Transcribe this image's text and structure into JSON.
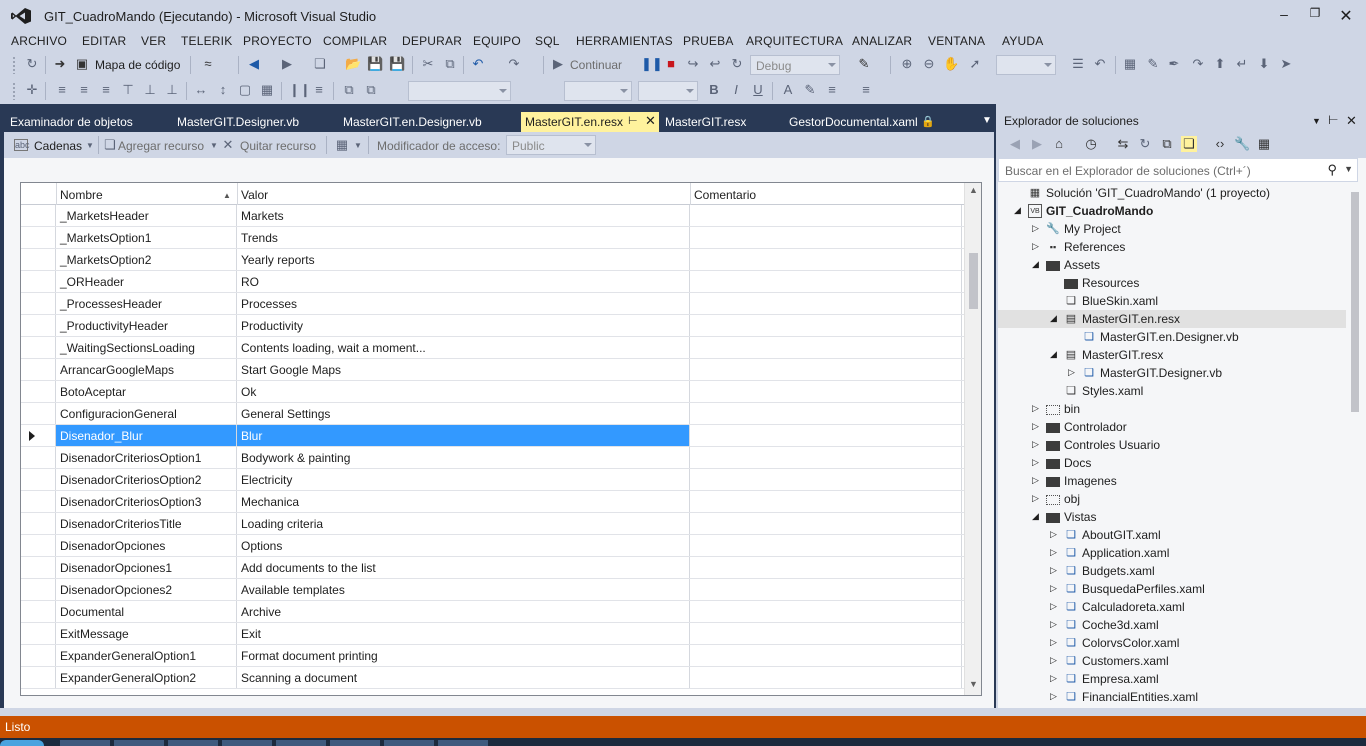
{
  "window": {
    "title": "GIT_CuadroMando (Ejecutando) - Microsoft Visual Studio"
  },
  "menu": [
    "ARCHIVO",
    "EDITAR",
    "VER",
    "TELERIK",
    "PROYECTO",
    "COMPILAR",
    "DEPURAR",
    "EQUIPO",
    "SQL",
    "HERRAMIENTAS",
    "PRUEBA",
    "ARQUITECTURA",
    "ANALIZAR",
    "VENTANA",
    "AYUDA"
  ],
  "toolbar": {
    "code_map": "Mapa de código",
    "continue": "Continuar",
    "config": "Debug"
  },
  "tabs": [
    {
      "label": "Examinador de objetos"
    },
    {
      "label": "MasterGIT.Designer.vb"
    },
    {
      "label": "MasterGIT.en.Designer.vb"
    },
    {
      "label": "MasterGIT.en.resx",
      "active": true
    },
    {
      "label": "MasterGIT.resx"
    },
    {
      "label": "GestorDocumental.xaml"
    }
  ],
  "resx": {
    "toolbar": {
      "strings": "Cadenas",
      "add": "Agregar recurso",
      "remove": "Quitar recurso",
      "access_label": "Modificador de acceso:",
      "access_value": "Public"
    },
    "columns": {
      "name": "Nombre",
      "value": "Valor",
      "comment": "Comentario"
    },
    "rows": [
      {
        "name": "_MarketsHeader",
        "value": "Markets"
      },
      {
        "name": "_MarketsOption1",
        "value": "Trends"
      },
      {
        "name": "_MarketsOption2",
        "value": "Yearly reports"
      },
      {
        "name": "_ORHeader",
        "value": "RO"
      },
      {
        "name": "_ProcessesHeader",
        "value": "Processes"
      },
      {
        "name": "_ProductivityHeader",
        "value": "Productivity"
      },
      {
        "name": "_WaitingSectionsLoading",
        "value": "Contents loading, wait a moment..."
      },
      {
        "name": "ArrancarGoogleMaps",
        "value": "Start Google Maps"
      },
      {
        "name": "BotoAceptar",
        "value": "Ok"
      },
      {
        "name": "ConfiguracionGeneral",
        "value": "General Settings"
      },
      {
        "name": "Disenador_Blur",
        "value": "Blur",
        "selected": true
      },
      {
        "name": "DisenadorCriteriosOption1",
        "value": "Bodywork & painting"
      },
      {
        "name": "DisenadorCriteriosOption2",
        "value": "Electricity"
      },
      {
        "name": "DisenadorCriteriosOption3",
        "value": "Mechanica"
      },
      {
        "name": "DisenadorCriteriosTitle",
        "value": "Loading criteria"
      },
      {
        "name": "DisenadorOpciones",
        "value": "Options"
      },
      {
        "name": "DisenadorOpciones1",
        "value": "Add documents to the list"
      },
      {
        "name": "DisenadorOpciones2",
        "value": "Available templates"
      },
      {
        "name": "Documental",
        "value": "Archive"
      },
      {
        "name": "ExitMessage",
        "value": "Exit"
      },
      {
        "name": "ExpanderGeneralOption1",
        "value": "Format document printing"
      },
      {
        "name": "ExpanderGeneralOption2",
        "value": "Scanning a document"
      }
    ]
  },
  "solution_explorer": {
    "title": "Explorador de soluciones",
    "search_placeholder": "Buscar en el Explorador de soluciones (Ctrl+´)",
    "tree": [
      {
        "label": "Solución 'GIT_CuadroMando'  (1 proyecto)",
        "level": 0,
        "icon": "solution-icon",
        "exp": ""
      },
      {
        "label": "GIT_CuadroMando",
        "level": 0,
        "icon": "vb-project-icon",
        "exp": "open",
        "bold": true
      },
      {
        "label": "My Project",
        "level": 1,
        "icon": "wrench-icon",
        "exp": "closed"
      },
      {
        "label": "References",
        "level": 1,
        "icon": "references-icon",
        "exp": "closed"
      },
      {
        "label": "Assets",
        "level": 1,
        "icon": "folder-icon",
        "exp": "open"
      },
      {
        "label": "Resources",
        "level": 2,
        "icon": "folder-icon",
        "exp": ""
      },
      {
        "label": "BlueSkin.xaml",
        "level": 2,
        "icon": "file-icon",
        "exp": ""
      },
      {
        "label": "MasterGIT.en.resx",
        "level": 2,
        "icon": "resx-icon",
        "exp": "open",
        "highlight": true
      },
      {
        "label": "MasterGIT.en.Designer.vb",
        "level": 3,
        "icon": "vb-file-icon",
        "exp": ""
      },
      {
        "label": "MasterGIT.resx",
        "level": 2,
        "icon": "resx-icon",
        "exp": "open"
      },
      {
        "label": "MasterGIT.Designer.vb",
        "level": 3,
        "icon": "vb-file-icon",
        "exp": "closed"
      },
      {
        "label": "Styles.xaml",
        "level": 2,
        "icon": "file-icon",
        "exp": ""
      },
      {
        "label": "bin",
        "level": 1,
        "icon": "dotted-folder-icon",
        "exp": "closed"
      },
      {
        "label": "Controlador",
        "level": 1,
        "icon": "folder-icon",
        "exp": "closed"
      },
      {
        "label": "Controles Usuario",
        "level": 1,
        "icon": "folder-icon",
        "exp": "closed"
      },
      {
        "label": "Docs",
        "level": 1,
        "icon": "folder-icon",
        "exp": "closed"
      },
      {
        "label": "Imagenes",
        "level": 1,
        "icon": "folder-icon",
        "exp": "closed"
      },
      {
        "label": "obj",
        "level": 1,
        "icon": "dotted-folder-icon",
        "exp": "closed"
      },
      {
        "label": "Vistas",
        "level": 1,
        "icon": "folder-icon",
        "exp": "open"
      },
      {
        "label": "AboutGIT.xaml",
        "level": 2,
        "icon": "xaml-file-icon",
        "exp": "closed"
      },
      {
        "label": "Application.xaml",
        "level": 2,
        "icon": "xaml-file-icon",
        "exp": "closed"
      },
      {
        "label": "Budgets.xaml",
        "level": 2,
        "icon": "xaml-file-icon",
        "exp": "closed"
      },
      {
        "label": "BusquedaPerfiles.xaml",
        "level": 2,
        "icon": "xaml-file-icon",
        "exp": "closed"
      },
      {
        "label": "Calculadoreta.xaml",
        "level": 2,
        "icon": "xaml-file-icon",
        "exp": "closed"
      },
      {
        "label": "Coche3d.xaml",
        "level": 2,
        "icon": "xaml-file-icon",
        "exp": "closed"
      },
      {
        "label": "ColorvsColor.xaml",
        "level": 2,
        "icon": "xaml-file-icon",
        "exp": "closed"
      },
      {
        "label": "Customers.xaml",
        "level": 2,
        "icon": "xaml-file-icon",
        "exp": "closed"
      },
      {
        "label": "Empresa.xaml",
        "level": 2,
        "icon": "xaml-file-icon",
        "exp": "closed"
      },
      {
        "label": "FinancialEntities.xaml",
        "level": 2,
        "icon": "xaml-file-icon",
        "exp": "closed"
      }
    ]
  },
  "status": {
    "text": "Listo"
  },
  "colors": {
    "selection": "#3399ff",
    "status_bar": "#ca5100",
    "active_tab": "#fff29d",
    "tab_well": "#293955"
  }
}
